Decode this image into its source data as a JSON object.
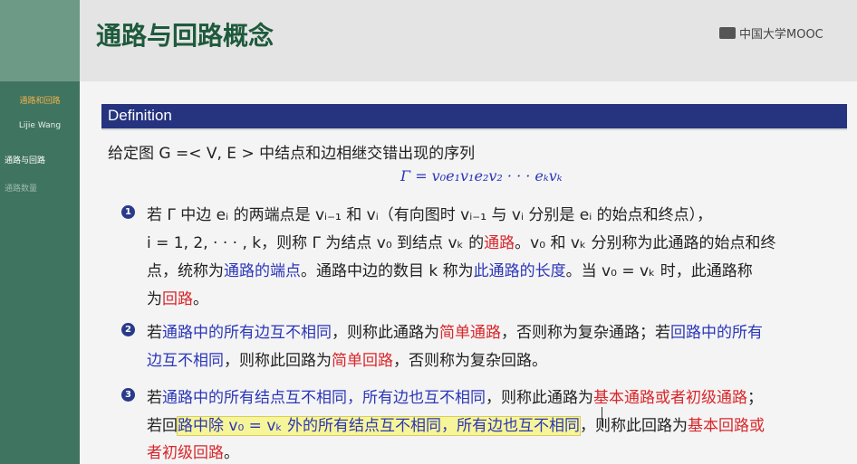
{
  "sidebar": {
    "items": [
      {
        "label": "通路和回路"
      },
      {
        "label": "Lijie Wang"
      },
      {
        "label": "通路与回路"
      },
      {
        "label": "通路数量"
      }
    ]
  },
  "header": {
    "title": "通路与回路概念",
    "logo_text": "中国大学MOOC"
  },
  "definition": {
    "title": "Definition",
    "intro": "给定图 G =< V, E > 中结点和边相继交错出现的序列",
    "formula": "Γ = v₀e₁v₁e₂v₂ · · · eₖvₖ"
  },
  "items": [
    {
      "number": "1",
      "lines": [
        "若 Γ 中边 eᵢ 的两端点是 vᵢ₋₁ 和 vᵢ（有向图时 vᵢ₋₁ 与 vᵢ 分别是 eᵢ 的始点和终点），",
        "i = 1, 2, · · · , k，则称 Γ 为结点 v₀ 到结点 vₖ 的",
        "通路",
        "。v₀ 和 vₖ 分别称为此通路的始点和终",
        "点，统称为",
        "通路的端点",
        "。通路中边的数目 k 称为",
        "此通路的长度",
        "。当 v₀ = vₖ 时，此通路称",
        "为",
        "回路",
        "。"
      ]
    },
    {
      "number": "2",
      "parts": [
        "若",
        "通路中的所有边互不相同",
        "，则称此通路为",
        "简单通路",
        "，否则称为复杂通路；若",
        "回路中的所有",
        "边互不相同",
        "，则称此回路为",
        "简单回路",
        "，否则称为复杂回路。"
      ]
    },
    {
      "number": "3",
      "parts": [
        "若",
        "通路中的所有结点互不相同，所有边也互不相同",
        "，则称此通路为",
        "基本通路或者初级通路",
        "；",
        "若回",
        "路中除 v₀ = vₖ 外的所有结点互不相同，所有边也互不相同",
        "，则称此回路为",
        "基本回路或",
        "者初级回路",
        "。"
      ]
    }
  ],
  "colors": {
    "sidebar": "#3f7460",
    "title": "#1e5a3c",
    "definition_bar": "#26337f",
    "blue_term": "#2b36b8",
    "red_term": "#d8262a",
    "highlight": "#f7f59a"
  }
}
